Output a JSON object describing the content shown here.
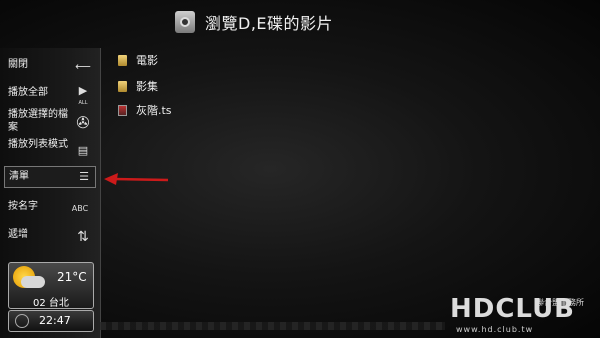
{
  "header": {
    "title": "瀏覽D,E碟的影片",
    "icon": "media-drive-icon"
  },
  "sidebar": {
    "items": [
      {
        "label": "關閉",
        "icon": "close-arrow-icon",
        "glyph": "⟵"
      },
      {
        "label": "播放全部",
        "icon": "play-all-icon",
        "glyph": "▶"
      },
      {
        "label": "播放選擇的檔案",
        "icon": "film-reel-icon",
        "glyph": "✇"
      },
      {
        "label": "播放列表模式",
        "icon": "playlist-icon",
        "glyph": "▤"
      },
      {
        "label": "清單",
        "icon": "list-icon",
        "glyph": "☰"
      },
      {
        "label": "按名字",
        "icon": "abc-sort-icon",
        "glyph": "ABC"
      },
      {
        "label": "遞增",
        "icon": "sort-ascending-icon",
        "glyph": "⇅"
      }
    ],
    "play_all_badge": "ALL"
  },
  "weather": {
    "temperature": "21°C",
    "location": "02 台北",
    "icon": "partly-cloudy-icon"
  },
  "clock": {
    "time": "22:47"
  },
  "files": [
    {
      "name": "電影",
      "type": "folder"
    },
    {
      "name": "影集",
      "type": "folder"
    },
    {
      "name": "灰階.ts",
      "type": "video"
    }
  ],
  "watermark": {
    "logo": "HDCLUB",
    "subtitle": "聯合盟事務所",
    "url": "www.hd.club.tw"
  },
  "colors": {
    "arrow": "#cc1a1a",
    "folder": "#d9b24c"
  }
}
